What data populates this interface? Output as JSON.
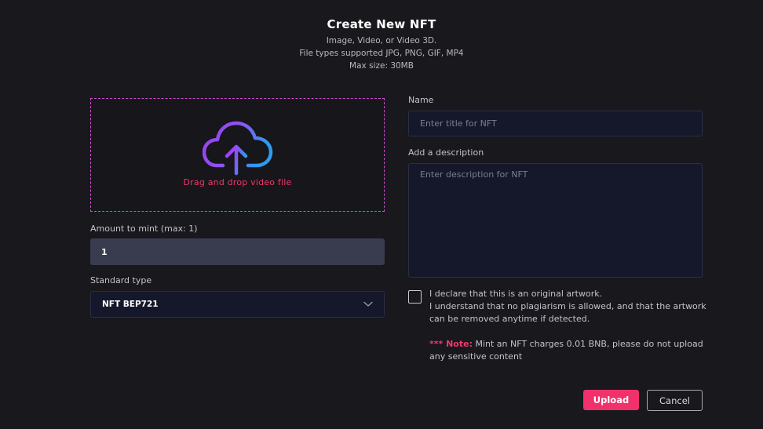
{
  "header": {
    "title": "Create New NFT",
    "line1": "Image, Video, or Video 3D.",
    "line2": "File types supported JPG, PNG, GIF, MP4",
    "line3": "Max size: 30MB"
  },
  "dropzone": {
    "icon": "cloud-upload-icon",
    "text": "Drag and drop video file",
    "gradient": [
      "#a23cf0",
      "#2e9bf0"
    ],
    "border_color": "#d44bd8"
  },
  "amount": {
    "label": "Amount to mint (max: 1)",
    "value": "1"
  },
  "standard": {
    "label": "Standard type",
    "value": "NFT BEP721",
    "icon": "chevron-down-icon"
  },
  "name": {
    "label": "Name",
    "placeholder": "Enter title for NFT"
  },
  "description": {
    "label": "Add a description",
    "placeholder": "Enter description for NFT"
  },
  "declaration": {
    "checked": false,
    "line1": "I declare that this is an original artwork.",
    "line2": "I understand that no plagiarism is allowed, and that the artwork can be removed anytime if detected."
  },
  "note": {
    "prefix": "*** Note:",
    "text": " Mint an NFT charges 0.01 BNB, please do not upload any sensitive content"
  },
  "actions": {
    "upload_label": "Upload",
    "cancel_label": "Cancel"
  },
  "colors": {
    "accent": "#f0316b",
    "background": "#18181d",
    "input_bg": "#15182a"
  }
}
